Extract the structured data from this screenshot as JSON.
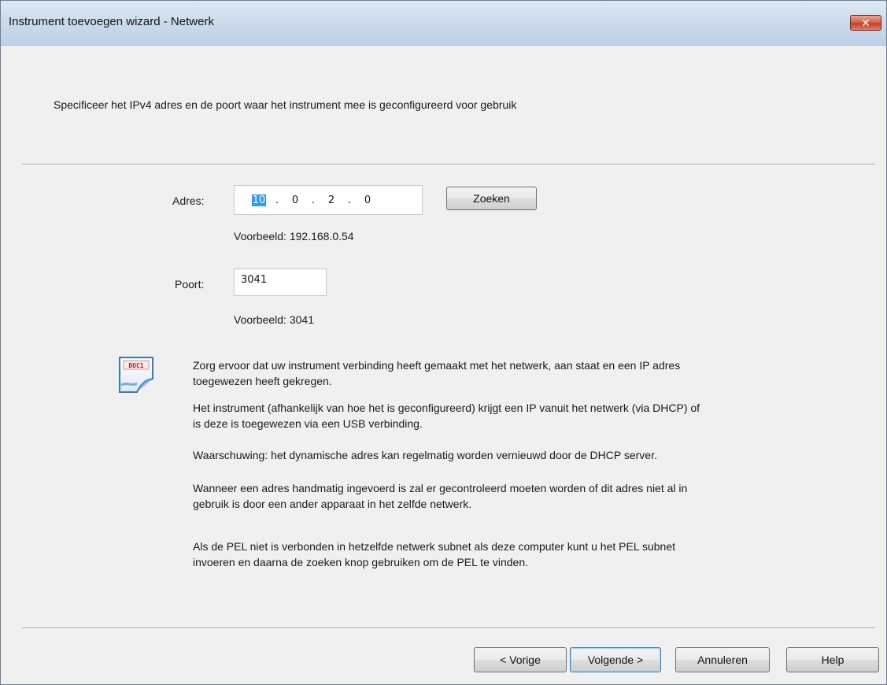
{
  "window": {
    "title": "Instrument toevoegen wizard - Netwerk",
    "close_label": "✕"
  },
  "header": {
    "instruction": "Specificeer het IPv4 adres en de poort waar het instrument mee is geconfigureerd voor gebruik"
  },
  "address": {
    "label": "Adres:",
    "octets": [
      "10",
      "0",
      "2",
      "0"
    ],
    "separator": ".",
    "search_button": "Zoeken",
    "example": "Voorbeeld: 192.168.0.54"
  },
  "port": {
    "label": "Poort:",
    "value": "3041",
    "example": "Voorbeeld: 3041"
  },
  "info": {
    "icon": "document-icon",
    "icon_text": "DOC1",
    "p1_line1": "Zorg ervoor dat uw instrument verbinding heeft gemaakt met het netwerk, aan staat en een IP adres",
    "p1_line2": "toegewezen heeft gekregen.",
    "p2_line1": "Het instrument (afhankelijk van hoe het is geconfigureerd) krijgt een IP vanuit het netwerk (via DHCP) of",
    "p2_line2": "is deze is toegewezen via een USB verbinding.",
    "p3": "Waarschuwing: het dynamische adres kan regelmatig worden vernieuwd door de DHCP server.",
    "p4_line1": "Wanneer een adres handmatig ingevoerd is zal er gecontroleerd moeten worden of dit adres niet al in",
    "p4_line2": "gebruik is door een ander apparaat in het zelfde netwerk.",
    "p5_line1": "Als de PEL niet is verbonden in hetzelfde netwerk subnet als deze computer kunt u het PEL subnet",
    "p5_line2": "invoeren en daarna de zoeken knop gebruiken om de PEL te vinden."
  },
  "footer": {
    "back": "< Vorige",
    "next": "Volgende >",
    "cancel": "Annuleren",
    "help": "Help"
  },
  "colors": {
    "titlebar": "#c9d8ea",
    "client_bg": "#f0f0f0",
    "selection": "#3399ff",
    "close_red": "#c2402a"
  }
}
